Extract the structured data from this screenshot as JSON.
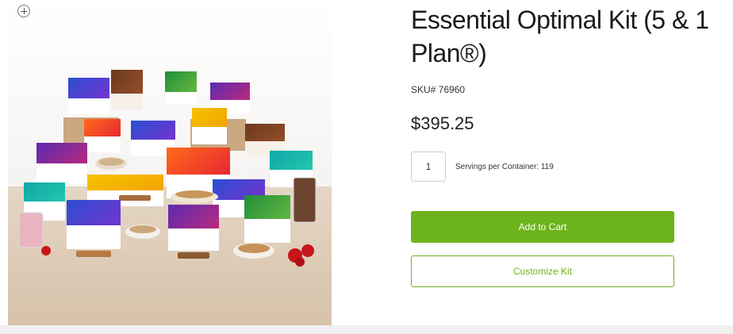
{
  "product": {
    "title": "Essential Optimal Kit (5 & 1 Plan®)",
    "sku": "SKU# 76960",
    "price": "$395.25",
    "quantity": "1",
    "servings": "Servings per Container: 119"
  },
  "actions": {
    "add_to_cart": "Add to Cart",
    "customize": "Customize Kit"
  },
  "colors": {
    "accent": "#6db31b"
  },
  "icons": {
    "zoom": "zoom-in-icon"
  }
}
